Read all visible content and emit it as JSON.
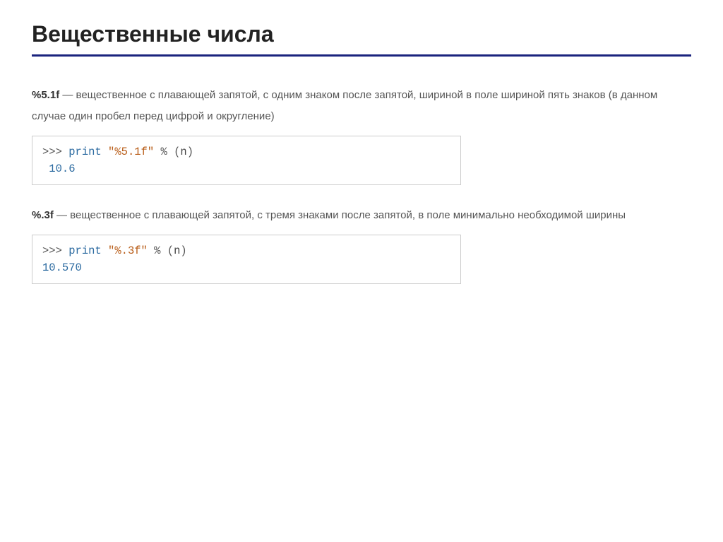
{
  "title": "Вещественные числа",
  "sections": [
    {
      "fmt": "%5.1f",
      "desc_rest": " — вещественное с плавающей запятой, с одним знаком после запятой, шириной в поле шириной пять знаков (в данном случае один пробел перед цифрой и округление)",
      "code": {
        "prompt": ">>> ",
        "kw": "print",
        "sp1": " ",
        "str": "\"%5.1f\"",
        "sp2": " ",
        "pct": "%",
        "sp3": " ",
        "lpar": "(",
        "arg": "n",
        "rpar": ")",
        "output": " 10.6"
      }
    },
    {
      "fmt": "%.3f",
      "desc_rest": " — вещественное с плавающей запятой, с тремя знаками после запятой, в поле минимально необходимой ширины",
      "code": {
        "prompt": ">>> ",
        "kw": "print",
        "sp1": " ",
        "str": "\"%.3f\"",
        "sp2": " ",
        "pct": "%",
        "sp3": " ",
        "lpar": "(",
        "arg": "n",
        "rpar": ")",
        "output": "10.570"
      }
    }
  ]
}
